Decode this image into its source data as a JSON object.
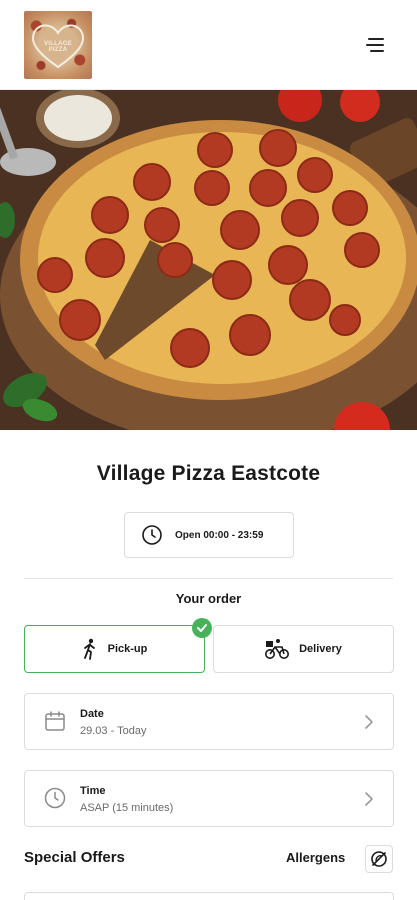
{
  "header": {
    "logo_text": "VILLAGE PIZZA",
    "menu_icon": "hamburger-menu-icon"
  },
  "restaurant": {
    "name": "Village Pizza Eastcote",
    "hours": "Open 00:00 - 23:59"
  },
  "order": {
    "heading": "Your order",
    "modes": [
      {
        "label": "Pick-up",
        "icon": "walking-person-icon",
        "selected": true
      },
      {
        "label": "Delivery",
        "icon": "bicycle-courier-icon",
        "selected": false
      }
    ],
    "date": {
      "label": "Date",
      "value": "29.03 - Today"
    },
    "time": {
      "label": "Time",
      "value": "ASAP (15 minutes)"
    }
  },
  "sections": {
    "special_offers": "Special Offers",
    "allergens": "Allergens"
  },
  "colors": {
    "accent_green": "#47b25a",
    "border": "#dcdcdc",
    "text": "#1a1a1a",
    "muted": "#6a6a6a"
  }
}
